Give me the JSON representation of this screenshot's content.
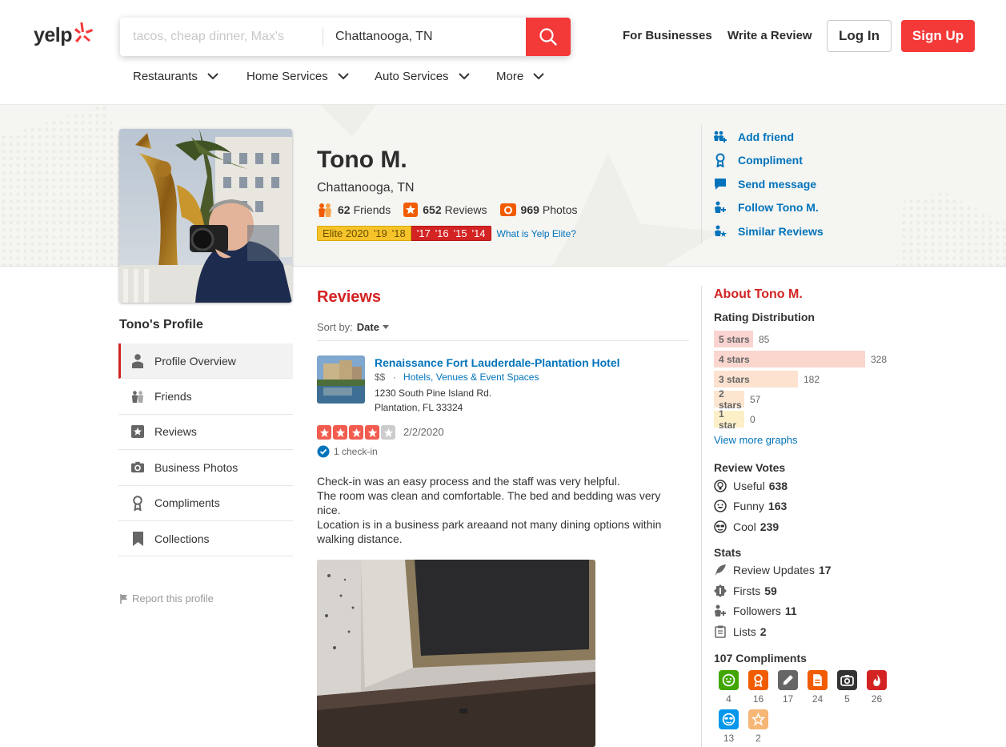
{
  "header": {
    "logo_text": "yelp",
    "search_find_placeholder": "tacos, cheap dinner, Max's",
    "search_near_value": "Chattanooga, TN",
    "for_businesses": "For Businesses",
    "write_review": "Write a Review",
    "login": "Log In",
    "signup": "Sign Up",
    "brand_red": "#d32323"
  },
  "categories": [
    "Restaurants",
    "Home Services",
    "Auto Services",
    "More"
  ],
  "profile": {
    "name": "Tono M.",
    "location": "Chattanooga, TN",
    "friends_count": "62",
    "friends_label": "Friends",
    "reviews_count": "652",
    "reviews_label": "Reviews",
    "photos_count": "969",
    "photos_label": "Photos",
    "elite_years_gold": [
      "Elite 2020",
      "'19",
      "'18"
    ],
    "elite_years_red": [
      "'17",
      "'16",
      "'15",
      "'14"
    ],
    "elite_link": "What is Yelp Elite?"
  },
  "actions": [
    "Add friend",
    "Compliment",
    "Send message",
    "Follow Tono M.",
    "Similar Reviews"
  ],
  "sidebar": {
    "title": "Tono's Profile",
    "items": [
      "Profile Overview",
      "Friends",
      "Reviews",
      "Business Photos",
      "Compliments",
      "Collections"
    ],
    "report": "Report this profile"
  },
  "reviews": {
    "heading": "Reviews",
    "sort_label": "Sort by:",
    "sort_value": "Date",
    "item": {
      "business_name": "Renaissance Fort Lauderdale-Plantation Hotel",
      "price": "$$",
      "category": "Hotels, Venues & Event Spaces",
      "address_line1": "1230 South Pine Island Rd.",
      "address_line2": "Plantation, FL 33324",
      "rating": 4,
      "date": "2/2/2020",
      "checkin": "1 check-in",
      "text": [
        "Check-in was an easy process and the staff was very helpful.",
        "The room was clean and comfortable. The bed and bedding was very nice.",
        "Location is in a business park areaand not many dining options within walking distance."
      ]
    }
  },
  "about": {
    "title": "About Tono M.",
    "rating_title": "Rating Distribution",
    "distribution": [
      {
        "label": "5 stars",
        "count": 85,
        "color": "#f9d4d0"
      },
      {
        "label": "4 stars",
        "count": 328,
        "color": "#fad6cf"
      },
      {
        "label": "3 stars",
        "count": 182,
        "color": "#fce2cf"
      },
      {
        "label": "2 stars",
        "count": 57,
        "color": "#fde6cf"
      },
      {
        "label": "1 star",
        "count": 0,
        "color": "#fdf0c8"
      }
    ],
    "more_graphs": "View more graphs",
    "votes_title": "Review Votes",
    "votes": [
      {
        "label": "Useful",
        "value": "638"
      },
      {
        "label": "Funny",
        "value": "163"
      },
      {
        "label": "Cool",
        "value": "239"
      }
    ],
    "stats_title": "Stats",
    "stats": [
      {
        "label": "Review Updates",
        "value": "17"
      },
      {
        "label": "Firsts",
        "value": "59"
      },
      {
        "label": "Followers",
        "value": "11"
      },
      {
        "label": "Lists",
        "value": "2"
      }
    ],
    "compliments_title": "107 Compliments",
    "compliments": [
      {
        "icon": "smile-icon",
        "color": "#41a700",
        "count": "4"
      },
      {
        "icon": "ribbon-icon",
        "color": "#f15c00",
        "count": "16"
      },
      {
        "icon": "pencil-icon",
        "color": "#666666",
        "count": "17"
      },
      {
        "icon": "document-icon",
        "color": "#f15c00",
        "count": "24"
      },
      {
        "icon": "camera-icon",
        "color": "#333333",
        "count": "5"
      },
      {
        "icon": "flame-icon",
        "color": "#d32323",
        "count": "26"
      },
      {
        "icon": "cool-face-icon",
        "color": "#0097ec",
        "count": "13"
      },
      {
        "icon": "star-outline-icon",
        "color": "#f6b675",
        "count": "2"
      }
    ]
  }
}
